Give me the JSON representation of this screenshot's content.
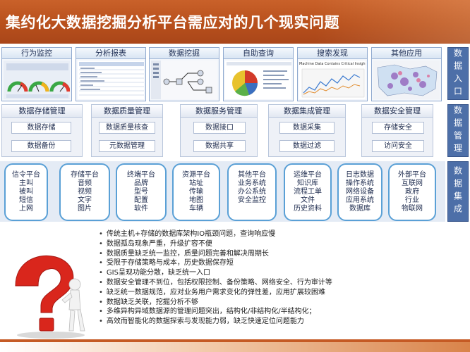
{
  "title": "集约化大数据挖掘分析平台需应对的几个现实问题",
  "apps": [
    {
      "label": "行为监控"
    },
    {
      "label": "分析报表"
    },
    {
      "label": "数据挖掘"
    },
    {
      "label": "自助查询"
    },
    {
      "label": "搜索发现"
    },
    {
      "label": "其他应用"
    }
  ],
  "search_subtitle": "Machine Data Contains Critical Insights",
  "side_labels": {
    "data_entry": "数据入口",
    "data_mgmt": "数据管理",
    "data_collect": "数据集成"
  },
  "management": [
    {
      "title": "数据存储管理",
      "items": [
        "数据存储",
        "数据备份"
      ]
    },
    {
      "title": "数据质量管理",
      "items": [
        "数据质量核查",
        "元数据管理"
      ]
    },
    {
      "title": "数据服务管理",
      "items": [
        "数据接口",
        "数据共享"
      ]
    },
    {
      "title": "数据集成管理",
      "items": [
        "数据采集",
        "数据过滤"
      ]
    },
    {
      "title": "数据安全管理",
      "items": [
        "存储安全",
        "访问安全"
      ]
    }
  ],
  "sources": [
    {
      "lines": [
        "信令平台",
        "主叫",
        "被叫",
        "短信",
        "上网"
      ]
    },
    {
      "lines": [
        "存储平台",
        "音频",
        "视频",
        "文字",
        "图片"
      ]
    },
    {
      "lines": [
        "终端平台",
        "品牌",
        "型号",
        "配置",
        "软件"
      ]
    },
    {
      "lines": [
        "资源平台",
        "站址",
        "传输",
        "地图",
        "车辆"
      ]
    },
    {
      "lines": [
        "其他平台",
        "业务系统",
        "办公系统",
        "安全监控"
      ]
    },
    {
      "lines": [
        "运维平台",
        "知识库",
        "流程工单",
        "文件",
        "历史资料"
      ]
    },
    {
      "lines": [
        "日志数据",
        "操作系统",
        "网络设备",
        "应用系统",
        "数据库"
      ]
    },
    {
      "lines": [
        "外部平台",
        "互联网",
        "政府",
        "行业",
        "物联网"
      ]
    }
  ],
  "issues": [
    "传统主机+存储的数据库架构IO瓶颈问题，查询响应慢",
    "数据孤岛现象严重，升级扩容不便",
    "数据质量缺乏统一监控，质量问题完善和解决周期长",
    "受限于存储策略与成本，历史数据保存短",
    "GIS呈现功能分散，缺乏统一入口",
    "数据安全管理不到位，包括权限控制、备份策略、网络安全、行为审计等",
    "缺乏统一数据规范，应对业务用户需求变化的弹性差，应用扩展较困难",
    "数据缺乏关联，挖掘分析不够",
    "多维异构异域数据源的管理问题突出，结构化/非结构化/半结构化；",
    "高效而智能化的数据探索与发现能力弱，缺乏快速定位问题能力"
  ],
  "colors": {
    "title_bg": "#b8501c",
    "side_label_bg": "#4d6fa8",
    "source_border": "#5aa0d6",
    "question_mark": "#d9261c"
  }
}
